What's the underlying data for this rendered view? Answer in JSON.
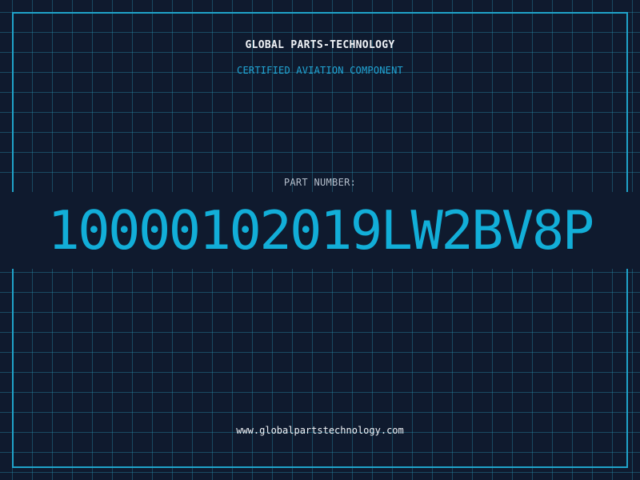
{
  "header": {
    "brand": "GLOBAL PARTS-TECHNOLOGY",
    "tagline": "CERTIFIED AVIATION COMPONENT"
  },
  "part": {
    "label": "PART NUMBER:",
    "number": "10000102019LW2BV8P"
  },
  "footer": {
    "website": "www.globalpartstechnology.com"
  },
  "colors": {
    "background": "#0f1a2e",
    "accent": "#1fa2c9",
    "part_number": "#12aed8",
    "text": "#f1f4f8"
  }
}
